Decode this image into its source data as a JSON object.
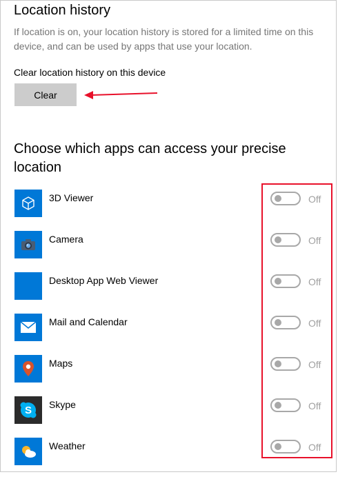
{
  "location_history": {
    "title": "Location history",
    "description": "If location is on, your location history is stored for a limited time on this device, and can be used by apps that use your location.",
    "clear_label": "Clear location history on this device",
    "clear_button": "Clear"
  },
  "apps_section": {
    "title": "Choose which apps can access your precise location",
    "apps": [
      {
        "name": "3D Viewer",
        "icon": "cube-icon",
        "state": "Off",
        "on": false
      },
      {
        "name": "Camera",
        "icon": "camera-icon",
        "state": "Off",
        "on": false
      },
      {
        "name": "Desktop App Web Viewer",
        "icon": "blank-app-icon",
        "state": "Off",
        "on": false
      },
      {
        "name": "Mail and Calendar",
        "icon": "mail-icon",
        "state": "Off",
        "on": false
      },
      {
        "name": "Maps",
        "icon": "map-pin-icon",
        "state": "Off",
        "on": false
      },
      {
        "name": "Skype",
        "icon": "skype-icon",
        "state": "Off",
        "on": false
      },
      {
        "name": "Weather",
        "icon": "weather-icon",
        "state": "Off",
        "on": false
      }
    ]
  },
  "colors": {
    "app_tile": "#0078d7",
    "skype_tile": "#2b2b2b",
    "toggle_off": "#a8a8a8",
    "annotation_red": "#e8102a",
    "button_bg": "#cccccc",
    "description_text": "#767676"
  }
}
